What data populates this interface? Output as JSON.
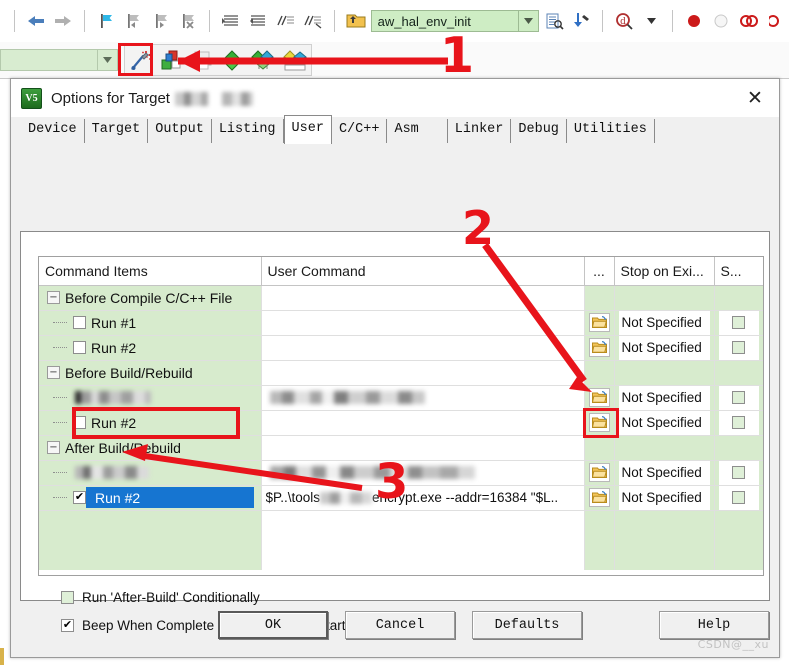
{
  "ide": {
    "toolbar1": {
      "icons": [
        {
          "name": "back-arrow-icon",
          "label": "Back"
        },
        {
          "name": "forward-arrow-icon",
          "label": "Forward"
        },
        {
          "name": "bookmark-toggle-icon",
          "label": "Insert/Remove Bookmark"
        },
        {
          "name": "bookmark-prev-icon",
          "label": "Previous Bookmark"
        },
        {
          "name": "bookmark-next-icon",
          "label": "Next Bookmark"
        },
        {
          "name": "bookmark-clear-icon",
          "label": "Clear All Bookmarks"
        },
        {
          "name": "indent-right-icon",
          "label": "Indent"
        },
        {
          "name": "indent-left-icon",
          "label": "Outdent"
        },
        {
          "name": "comment-icon",
          "label": "Comment"
        },
        {
          "name": "uncomment-icon",
          "label": "Uncomment"
        },
        {
          "name": "open-folder-icon",
          "label": "Open"
        }
      ],
      "combo_value": "aw_hal_env_init",
      "after_icons": [
        {
          "name": "browse-symbol-icon",
          "label": "Browse"
        },
        {
          "name": "find-in-files-icon",
          "label": "Find in Files"
        },
        {
          "name": "debug-search-icon",
          "label": "Debug Query"
        },
        {
          "name": "breakpoint-icon",
          "label": "Insert Breakpoint"
        },
        {
          "name": "breakpoint-disable-icon",
          "label": "Disable Breakpoint"
        },
        {
          "name": "breakpoint-kill-icon",
          "label": "Kill All Breakpoints"
        }
      ]
    },
    "toolbar2": {
      "combo_value": "",
      "icons": [
        {
          "name": "target-options-wizard-icon",
          "label": "Options for Target"
        },
        {
          "name": "manage-project-items-icon",
          "label": "Manage Project Items"
        },
        {
          "name": "print-icon",
          "label": "Print"
        },
        {
          "name": "batch-build-icon",
          "label": "Batch Build"
        },
        {
          "name": "multi-project-icon",
          "label": "Multi-Project"
        },
        {
          "name": "pack-installer-icon",
          "label": "Pack Installer"
        }
      ]
    }
  },
  "annotations": {
    "step1": "1",
    "step2": "2",
    "step3": "3",
    "color": "#e8141b"
  },
  "dialog": {
    "icon_name": "keil-uvision-icon",
    "icon_text": "V5",
    "title": "Options for Target",
    "title_redacted": true,
    "close_label": "✕",
    "tabs": [
      {
        "id": "device",
        "label": "Device",
        "active": false
      },
      {
        "id": "target",
        "label": "Target",
        "active": false
      },
      {
        "id": "output",
        "label": "Output",
        "active": false
      },
      {
        "id": "listing",
        "label": "Listing",
        "active": false
      },
      {
        "id": "user",
        "label": "User",
        "active": true
      },
      {
        "id": "cpp",
        "label": "C/C++",
        "active": false
      },
      {
        "id": "asm",
        "label": "Asm",
        "active": false
      },
      {
        "id": "linker",
        "label": "Linker",
        "active": false
      },
      {
        "id": "debug",
        "label": "Debug",
        "active": false
      },
      {
        "id": "utilities",
        "label": "Utilities",
        "active": false
      }
    ],
    "table": {
      "headers": {
        "command_items": "Command Items",
        "user_command": "User Command",
        "dots": "...",
        "stop_on_exit": "Stop on Exi...",
        "s": "S..."
      },
      "rows": [
        {
          "kind": "group",
          "label": "Before Compile C/C++ File",
          "expander": "−",
          "command": "",
          "has_folder": false,
          "stop": "",
          "s": false
        },
        {
          "kind": "item",
          "label": "Run #1",
          "checked": false,
          "command": "",
          "has_folder": true,
          "stop": "Not Specified",
          "s": false
        },
        {
          "kind": "item",
          "label": "Run #2",
          "checked": false,
          "command": "",
          "has_folder": true,
          "stop": "Not Specified",
          "s": false
        },
        {
          "kind": "group",
          "label": "Before Build/Rebuild",
          "expander": "−",
          "command": "",
          "has_folder": false,
          "stop": "",
          "s": false
        },
        {
          "kind": "item",
          "label": "",
          "label_redacted": true,
          "checked": false,
          "checkbox_redacted": true,
          "command": "",
          "command_redacted": true,
          "has_folder": true,
          "stop": "Not Specified",
          "s": false
        },
        {
          "kind": "item",
          "label": "Run #2",
          "checked": false,
          "command": "",
          "has_folder": true,
          "stop": "Not Specified",
          "s": false
        },
        {
          "kind": "group",
          "label": "After Build/Rebuild",
          "expander": "−",
          "command": "",
          "has_folder": false,
          "stop": "",
          "s": false
        },
        {
          "kind": "item",
          "label": "",
          "label_redacted": true,
          "checked": false,
          "checkbox_redacted": true,
          "command": "",
          "command_redacted": true,
          "has_folder": true,
          "stop": "Not Specified",
          "s": false
        },
        {
          "kind": "item",
          "label": "Run #2",
          "checked": true,
          "selected": true,
          "command": "$P..\\tools███encrypt.exe --addr=16384 \"$L..",
          "command_prefix": "$P..\\tools",
          "command_suffix": "encrypt.exe --addr=16384 \"$L..",
          "has_folder": true,
          "stop": "Not Specified",
          "s": false
        }
      ]
    },
    "options": [
      {
        "id": "run-after-build-conditionally",
        "label": "Run 'After-Build' Conditionally",
        "checked": false
      },
      {
        "id": "beep-when-complete",
        "label": "Beep When Complete",
        "checked": true
      },
      {
        "id": "start-debugging",
        "label": "Start Debugging",
        "checked": false
      }
    ],
    "buttons": [
      {
        "id": "ok",
        "label": "OK",
        "default": true
      },
      {
        "id": "cancel",
        "label": "Cancel",
        "default": false
      },
      {
        "id": "defaults",
        "label": "Defaults",
        "default": false
      },
      {
        "id": "help",
        "label": "Help",
        "default": false
      }
    ],
    "watermark": "CSDN@__xu"
  }
}
